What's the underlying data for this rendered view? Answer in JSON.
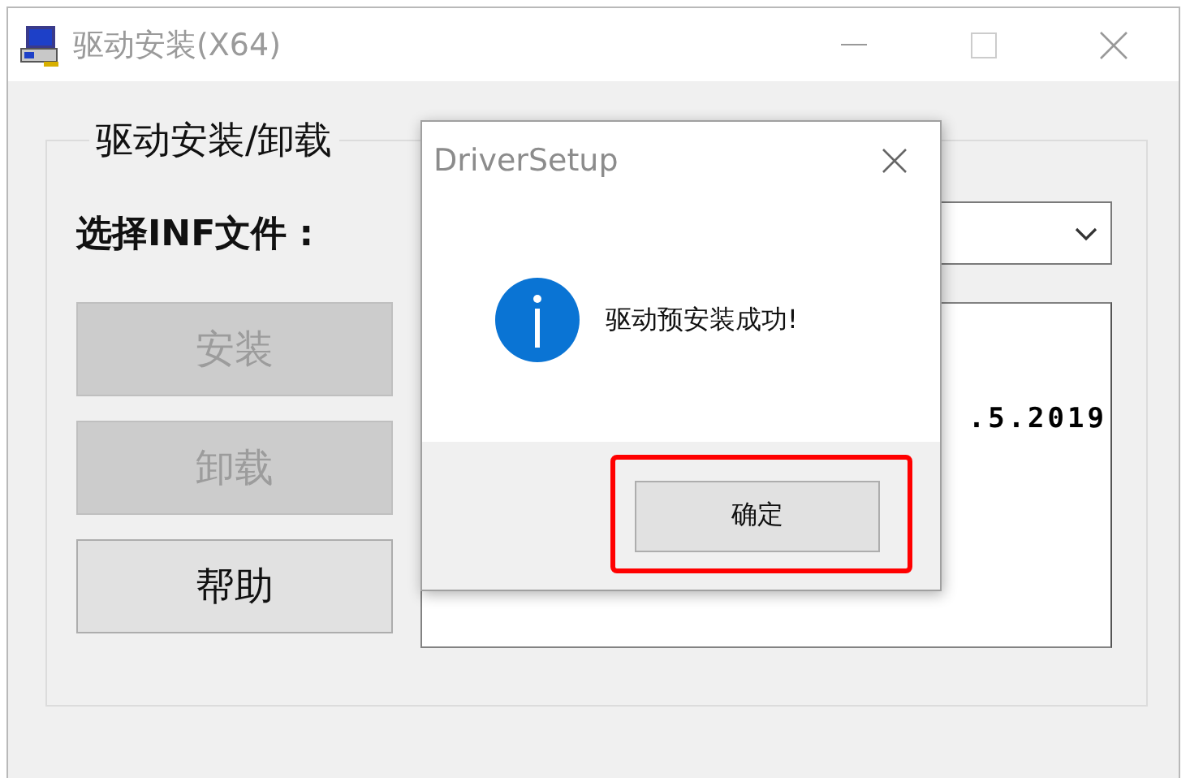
{
  "window": {
    "title": "驱动安装(X64)"
  },
  "group": {
    "title": "驱动安装/卸载",
    "inf_label": "选择INF文件 :",
    "buttons": [
      {
        "label": "安装",
        "disabled": true
      },
      {
        "label": "卸载",
        "disabled": true
      },
      {
        "label": "帮助",
        "disabled": false
      }
    ],
    "output_text": ".5.2019"
  },
  "dialog": {
    "title": "DriverSetup",
    "message": "驱动预安装成功!",
    "button": "确定",
    "highlighted": true
  }
}
